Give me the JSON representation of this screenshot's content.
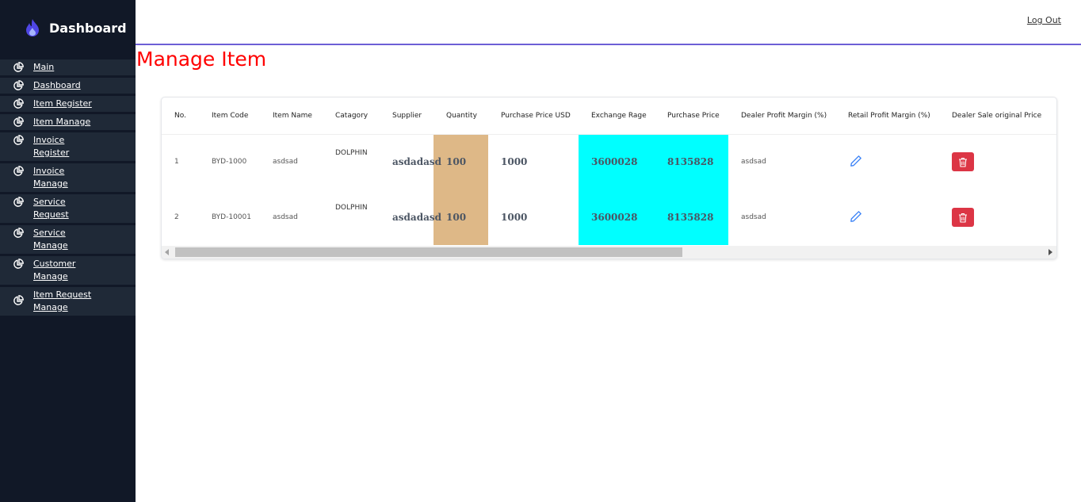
{
  "sidebar": {
    "brand_title": "Dashboard",
    "brand_icon": "flame-icon",
    "items": [
      {
        "label": "Main",
        "icon": "pie-chart-icon"
      },
      {
        "label": "Dashboard",
        "icon": "pie-chart-icon"
      },
      {
        "label": "Item Register",
        "icon": "pie-chart-icon"
      },
      {
        "label": "Item Manage",
        "icon": "pie-chart-icon"
      },
      {
        "label": "Invoice Register",
        "icon": "pie-chart-icon"
      },
      {
        "label": "Invoice Manage",
        "icon": "pie-chart-icon"
      },
      {
        "label": "Service Request",
        "icon": "pie-chart-icon"
      },
      {
        "label": "Service Manage",
        "icon": "pie-chart-icon"
      },
      {
        "label": "Customer Manage",
        "icon": "pie-chart-icon"
      },
      {
        "label": "Item Request Manage",
        "icon": "pie-chart-icon"
      }
    ]
  },
  "header": {
    "logout_label": "Log Out"
  },
  "main": {
    "title": "Manage Item",
    "table": {
      "columns": [
        "No.",
        "Item Code",
        "Item Name",
        "Catagory",
        "Supplier",
        "Quantity",
        "Purchase Price USD",
        "Exchange Rage",
        "Purchase Price",
        "Dealer Profit Margin (%)",
        "Retail Profit Margin (%)",
        "Dealer Sale original Price"
      ],
      "rows": [
        {
          "no": "1",
          "item_code": "BYD-1000",
          "item_name": "asdsad",
          "category": "DOLPHIN",
          "supplier": "asdadasd",
          "quantity": "100",
          "purchase_price_usd": "1000",
          "exchange_rate": "3600028",
          "purchase_price": "8135828",
          "dealer_margin": "asdsad"
        },
        {
          "no": "2",
          "item_code": "BYD-10001",
          "item_name": "asdsad",
          "category": "DOLPHIN",
          "supplier": "asdadasd",
          "quantity": "100",
          "purchase_price_usd": "1000",
          "exchange_rate": "3600028",
          "purchase_price": "8135828",
          "dealer_margin": "asdsad"
        }
      ],
      "row_actions": {
        "edit_icon": "pencil-icon",
        "delete_icon": "trash-icon"
      }
    }
  },
  "colors": {
    "sidebar_bg": "#111827",
    "nav_item_bg": "#1f2937",
    "title_color": "#ff0000",
    "header_border": "#6d5fd6",
    "quantity_bg": "#deb887",
    "price_bg": "#00ffff",
    "delete_button": "#dc3545",
    "edit_icon": "#3b82f6"
  }
}
